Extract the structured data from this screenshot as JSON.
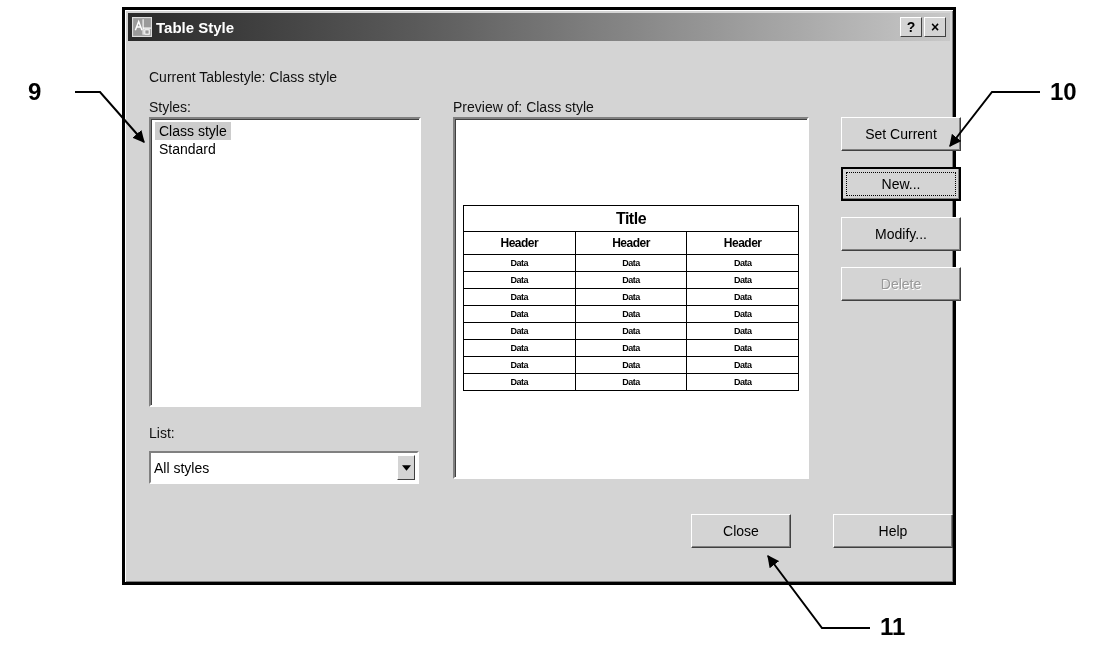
{
  "window": {
    "title": "Table Style",
    "title_buttons": [
      "?",
      "×"
    ]
  },
  "current_style": "Current Tablestyle: Class style",
  "styles": {
    "label": "Styles:",
    "items": [
      {
        "label": "Class style",
        "selected": true
      },
      {
        "label": "Standard",
        "selected": false
      }
    ]
  },
  "list": {
    "label": "List:",
    "value": "All styles"
  },
  "preview": {
    "label": "Preview of: Class style",
    "table": {
      "title": "Title",
      "headers": [
        "Header",
        "Header",
        "Header"
      ],
      "rows": [
        [
          "Data",
          "Data",
          "Data"
        ],
        [
          "Data",
          "Data",
          "Data"
        ],
        [
          "Data",
          "Data",
          "Data"
        ],
        [
          "Data",
          "Data",
          "Data"
        ],
        [
          "Data",
          "Data",
          "Data"
        ],
        [
          "Data",
          "Data",
          "Data"
        ],
        [
          "Data",
          "Data",
          "Data"
        ],
        [
          "Data",
          "Data",
          "Data"
        ]
      ]
    }
  },
  "side_buttons": [
    {
      "label": "Set Current",
      "disabled": false,
      "focused": false
    },
    {
      "label": "New...",
      "disabled": false,
      "focused": true
    },
    {
      "label": "Modify...",
      "disabled": false,
      "focused": false
    },
    {
      "label": "Delete",
      "disabled": true,
      "focused": false
    }
  ],
  "bottom_buttons": [
    {
      "label": "Close",
      "disabled": false,
      "focused": false
    },
    {
      "label": "Help",
      "disabled": false,
      "focused": false
    }
  ],
  "callouts": [
    "9",
    "10",
    "11"
  ]
}
